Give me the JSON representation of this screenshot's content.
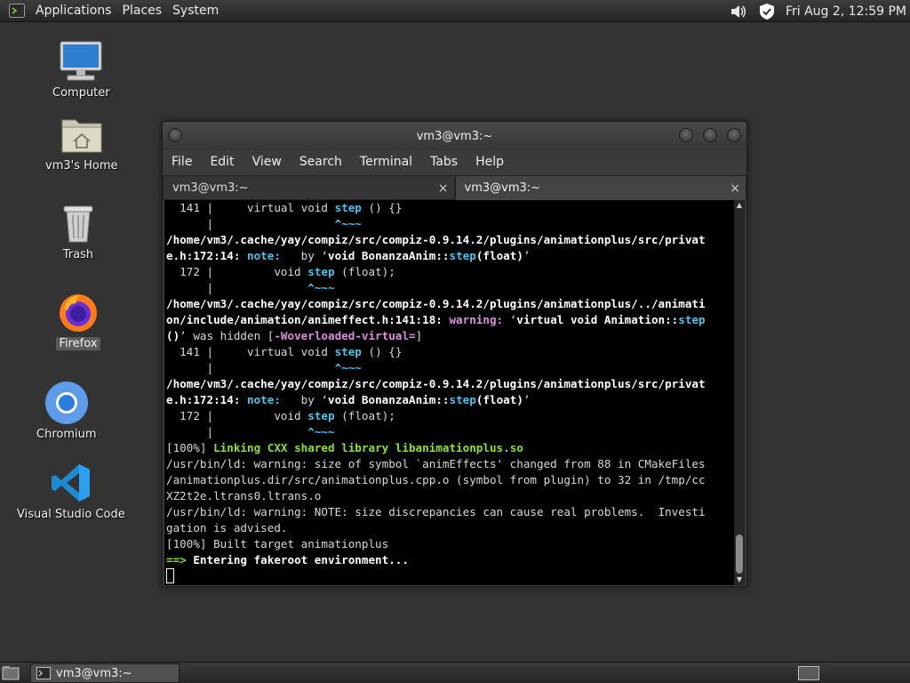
{
  "top_panel": {
    "menus": [
      "Applications",
      "Places",
      "System"
    ],
    "clock": "Fri Aug  2, 12:59 PM",
    "tray_icons": [
      "volume-icon",
      "shield-icon"
    ]
  },
  "desktop_icons": [
    {
      "label": "Computer",
      "icon": "computer-icon"
    },
    {
      "label": "vm3's Home",
      "icon": "home-folder-icon"
    },
    {
      "label": "Trash",
      "icon": "trash-icon"
    },
    {
      "label": "Firefox",
      "icon": "firefox-icon"
    },
    {
      "label": "Chromium",
      "icon": "chromium-icon"
    },
    {
      "label": "Visual Studio Code",
      "icon": "vscode-icon"
    }
  ],
  "terminal": {
    "title": "vm3@vm3:~",
    "menu": [
      "File",
      "Edit",
      "View",
      "Search",
      "Terminal",
      "Tabs",
      "Help"
    ],
    "tabs": [
      {
        "label": "vm3@vm3:~",
        "close": "×"
      },
      {
        "label": "vm3@vm3:~",
        "close": "×"
      }
    ],
    "lines": [
      {
        "parts": [
          {
            "t": "  141 |     virtual void "
          },
          {
            "t": "step",
            "c": "cy"
          },
          {
            "t": " () {}"
          }
        ]
      },
      {
        "parts": [
          {
            "t": "      |                  "
          },
          {
            "t": "^~~~",
            "c": "cy"
          }
        ]
      },
      {
        "parts": [
          {
            "t": "/home/vm3/.cache/yay/compiz/src/compiz-0.9.14.2/plugins/animationplus/src/privat",
            "c": "b"
          }
        ]
      },
      {
        "parts": [
          {
            "t": "e.h:172:14: ",
            "c": "b"
          },
          {
            "t": "note:",
            "c": "cy"
          },
          {
            "t": "   by ‘"
          },
          {
            "t": "void BonanzaAnim::",
            "c": "b"
          },
          {
            "t": "step",
            "c": "cy"
          },
          {
            "t": "(float)",
            "c": "b"
          },
          {
            "t": "’"
          }
        ]
      },
      {
        "parts": [
          {
            "t": "  172 |         void "
          },
          {
            "t": "step",
            "c": "cy"
          },
          {
            "t": " (float);"
          }
        ]
      },
      {
        "parts": [
          {
            "t": "      |              "
          },
          {
            "t": "^~~~",
            "c": "cy"
          }
        ]
      },
      {
        "parts": [
          {
            "t": "/home/vm3/.cache/yay/compiz/src/compiz-0.9.14.2/plugins/animationplus/../animati",
            "c": "b"
          }
        ]
      },
      {
        "parts": [
          {
            "t": "on/include/animation/animeffect.h:141:18: ",
            "c": "b"
          },
          {
            "t": "warning:",
            "c": "mg"
          },
          {
            "t": " ‘"
          },
          {
            "t": "virtual void Animation::",
            "c": "b"
          },
          {
            "t": "step",
            "c": "cy"
          }
        ]
      },
      {
        "parts": [
          {
            "t": "()",
            "c": "b"
          },
          {
            "t": "’ was hidden ["
          },
          {
            "t": "-Woverloaded-virtual=",
            "c": "mg"
          },
          {
            "t": "]"
          }
        ]
      },
      {
        "parts": [
          {
            "t": "  141 |     virtual void "
          },
          {
            "t": "step",
            "c": "cy"
          },
          {
            "t": " () {}"
          }
        ]
      },
      {
        "parts": [
          {
            "t": "      |                  "
          },
          {
            "t": "^~~~",
            "c": "cy"
          }
        ]
      },
      {
        "parts": [
          {
            "t": "/home/vm3/.cache/yay/compiz/src/compiz-0.9.14.2/plugins/animationplus/src/privat",
            "c": "b"
          }
        ]
      },
      {
        "parts": [
          {
            "t": "e.h:172:14: ",
            "c": "b"
          },
          {
            "t": "note:",
            "c": "cy"
          },
          {
            "t": "   by ‘"
          },
          {
            "t": "void BonanzaAnim::",
            "c": "b"
          },
          {
            "t": "step",
            "c": "cy"
          },
          {
            "t": "(float)",
            "c": "b"
          },
          {
            "t": "’"
          }
        ]
      },
      {
        "parts": [
          {
            "t": "  172 |         void "
          },
          {
            "t": "step",
            "c": "cy"
          },
          {
            "t": " (float);"
          }
        ]
      },
      {
        "parts": [
          {
            "t": "      |              "
          },
          {
            "t": "^~~~",
            "c": "cy"
          }
        ]
      },
      {
        "parts": [
          {
            "t": "[100%] "
          },
          {
            "t": "Linking CXX shared library libanimationplus.so",
            "c": "gr"
          }
        ]
      },
      {
        "parts": [
          {
            "t": "/usr/bin/ld: warning: size of symbol `animEffects' changed from 88 in CMakeFiles"
          }
        ]
      },
      {
        "parts": [
          {
            "t": "/animationplus.dir/src/animationplus.cpp.o (symbol from plugin) to 32 in /tmp/cc"
          }
        ]
      },
      {
        "parts": [
          {
            "t": "XZ2t2e.ltrans0.ltrans.o"
          }
        ]
      },
      {
        "parts": [
          {
            "t": "/usr/bin/ld: warning: NOTE: size discrepancies can cause real problems.  Investi"
          }
        ]
      },
      {
        "parts": [
          {
            "t": "gation is advised."
          }
        ]
      },
      {
        "parts": [
          {
            "t": "[100%] Built target animationplus"
          }
        ]
      },
      {
        "parts": [
          {
            "t": "==>",
            "c": "gr"
          },
          {
            "t": " Entering fakeroot environment...",
            "c": "b"
          }
        ]
      }
    ]
  },
  "taskbar": {
    "task_label": "vm3@vm3:~"
  }
}
